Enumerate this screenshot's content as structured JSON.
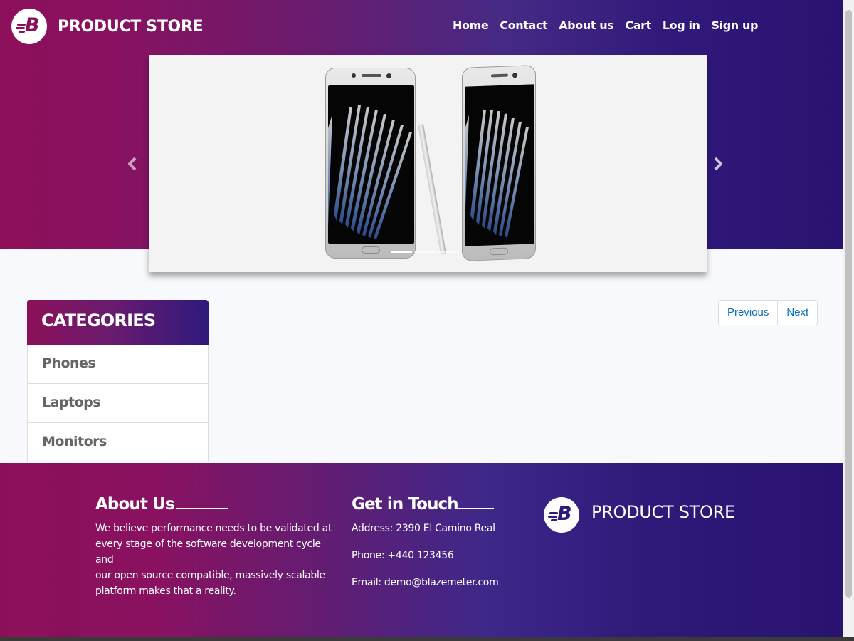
{
  "header": {
    "brand_name": "PRODUCT STORE",
    "logo_letter": "B",
    "nav": [
      {
        "label": "Home"
      },
      {
        "label": "Contact"
      },
      {
        "label": "About us"
      },
      {
        "label": "Cart"
      },
      {
        "label": "Log in"
      },
      {
        "label": "Sign up"
      }
    ]
  },
  "carousel": {
    "slides_count": 3,
    "active_slide": 1,
    "prev_icon": "chevron-left-icon",
    "next_icon": "chevron-right-icon"
  },
  "categories": {
    "title": "CATEGORIES",
    "items": [
      {
        "label": "Phones"
      },
      {
        "label": "Laptops"
      },
      {
        "label": "Monitors"
      }
    ]
  },
  "pager": {
    "previous_label": "Previous",
    "next_label": "Next"
  },
  "footer": {
    "about_title": "About Us",
    "about_text_lines": [
      "We believe performance needs to be validated at",
      "every stage of the software development cycle and",
      "our open source compatible, massively scalable",
      "platform makes that a reality."
    ],
    "contact_title": "Get in Touch",
    "address": "Address: 2390 El Camino Real",
    "phone": "Phone: +440 123456",
    "email": "Email: demo@blazemeter.com",
    "brand_name": "PRODUCT STORE"
  },
  "colors": {
    "brand_magenta": "#8c1059",
    "brand_indigo": "#2a1270",
    "link_blue": "#0a6ebd"
  }
}
